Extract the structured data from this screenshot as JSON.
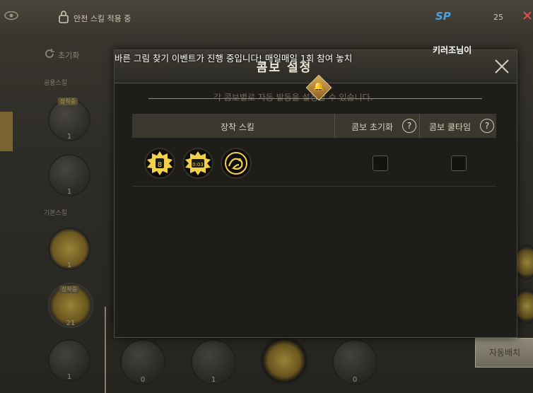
{
  "header": {
    "safety_text": "안전 스킬 적용 중",
    "sp_label": "SP",
    "sp_value": "25"
  },
  "left_panel": {
    "reset_label": "초기화",
    "common_skills_label": "공용스킬",
    "basic_skills_label": "기본스킬",
    "equipped_badge": "장착중",
    "skill_counts": [
      "1",
      "1",
      "1",
      "21",
      "1"
    ]
  },
  "bottom_bar": {
    "counts": [
      "0",
      "1",
      "0"
    ]
  },
  "modal": {
    "title": "콤보 설정",
    "description": "각 콤보별로 자동 발동을 설정할 수 있습니다.",
    "columns": {
      "equip_skill": "장착 스킬",
      "combo_reset": "콤보 초기화",
      "combo_cooltime": "콤보 쿨타임",
      "help_symbol": "?"
    },
    "rows": [
      {
        "skills": [
          "skill-slot-a-icon",
          "skill-slot-b-icon",
          "dragon-skill-icon"
        ],
        "combo_reset_checked": false,
        "combo_cooltime_checked": false
      }
    ]
  },
  "chat": {
    "caster_name": "키러조님이",
    "notice": "바른 그림 찾기 이벤트가 진행 중입니다! 매일매일 1회 참여 놓치"
  },
  "auto_button_label": "자동배치",
  "colors": {
    "gold": "#d9ab5a",
    "skill_yellow": "#f2d14a",
    "sp_blue": "#4aa3e0"
  }
}
